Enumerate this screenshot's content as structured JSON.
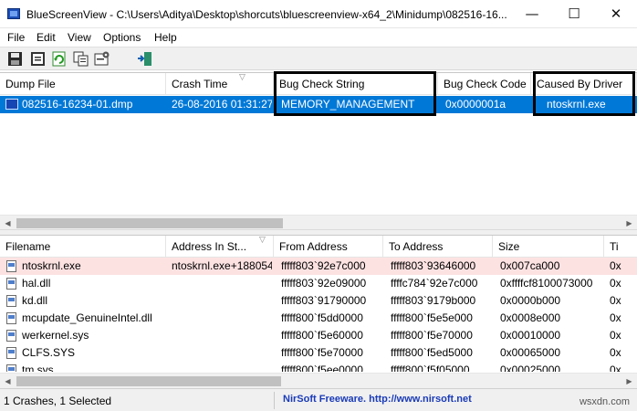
{
  "window": {
    "title": "BlueScreenView  -  C:\\Users\\Aditya\\Desktop\\shorcuts\\bluescreenview-x64_2\\Minidump\\082516-16...",
    "minimize_glyph": "—",
    "maximize_glyph": "☐",
    "close_glyph": "✕"
  },
  "menu": [
    "File",
    "Edit",
    "View",
    "Options",
    "Help"
  ],
  "toolbar": [
    "save-icon",
    "properties-icon",
    "refresh-icon",
    "copy-icon",
    "advanced-options-icon",
    "exit-icon"
  ],
  "top_table": {
    "columns": [
      "Dump File",
      "Crash Time",
      "Bug Check String",
      "Bug Check Code",
      "Caused By Driver"
    ],
    "sort_indicator": "▽",
    "rows": [
      {
        "dump_file": "082516-16234-01.dmp",
        "crash_time": "26-08-2016 01:31:27",
        "bug_check_string": "MEMORY_MANAGEMENT",
        "bug_check_code": "0x0000001a",
        "caused_by_driver": "ntoskrnl.exe"
      }
    ]
  },
  "bottom_table": {
    "columns": [
      "Filename",
      "Address In St...",
      "From Address",
      "To Address",
      "Size",
      "Ti"
    ],
    "rows": [
      {
        "filename": "ntoskrnl.exe",
        "address_in_stack": "ntoskrnl.exe+188054",
        "from_address": "fffff803`92e7c000",
        "to_address": "fffff803`93646000",
        "size": "0x007ca000",
        "extra": "0x"
      },
      {
        "filename": "hal.dll",
        "address_in_stack": "",
        "from_address": "fffff803`92e09000",
        "to_address": "ffffc784`92e7c000",
        "size": "0xffffcf8100073000",
        "extra": "0x"
      },
      {
        "filename": "kd.dll",
        "address_in_stack": "",
        "from_address": "fffff803`91790000",
        "to_address": "fffff803`9179b000",
        "size": "0x0000b000",
        "extra": "0x"
      },
      {
        "filename": "mcupdate_GenuineIntel.dll",
        "address_in_stack": "",
        "from_address": "fffff800`f5dd0000",
        "to_address": "fffff800`f5e5e000",
        "size": "0x0008e000",
        "extra": "0x"
      },
      {
        "filename": "werkernel.sys",
        "address_in_stack": "",
        "from_address": "fffff800`f5e60000",
        "to_address": "fffff800`f5e70000",
        "size": "0x00010000",
        "extra": "0x"
      },
      {
        "filename": "CLFS.SYS",
        "address_in_stack": "",
        "from_address": "fffff800`f5e70000",
        "to_address": "fffff800`f5ed5000",
        "size": "0x00065000",
        "extra": "0x"
      },
      {
        "filename": "tm.sys",
        "address_in_stack": "",
        "from_address": "fffff800`f5ee0000",
        "to_address": "fffff800`f5f05000",
        "size": "0x00025000",
        "extra": "0x"
      }
    ]
  },
  "scrollbar": {
    "left_glyph": "◀",
    "right_glyph": "▶"
  },
  "status": {
    "summary": "1 Crashes, 1 Selected",
    "link": "NirSoft Freeware.  http://www.nirsoft.net"
  },
  "watermark": "wsxdn.com",
  "colors": {
    "selection": "#0078d7",
    "highlight_row": "#fde2e2",
    "link": "#1a3bb8"
  }
}
